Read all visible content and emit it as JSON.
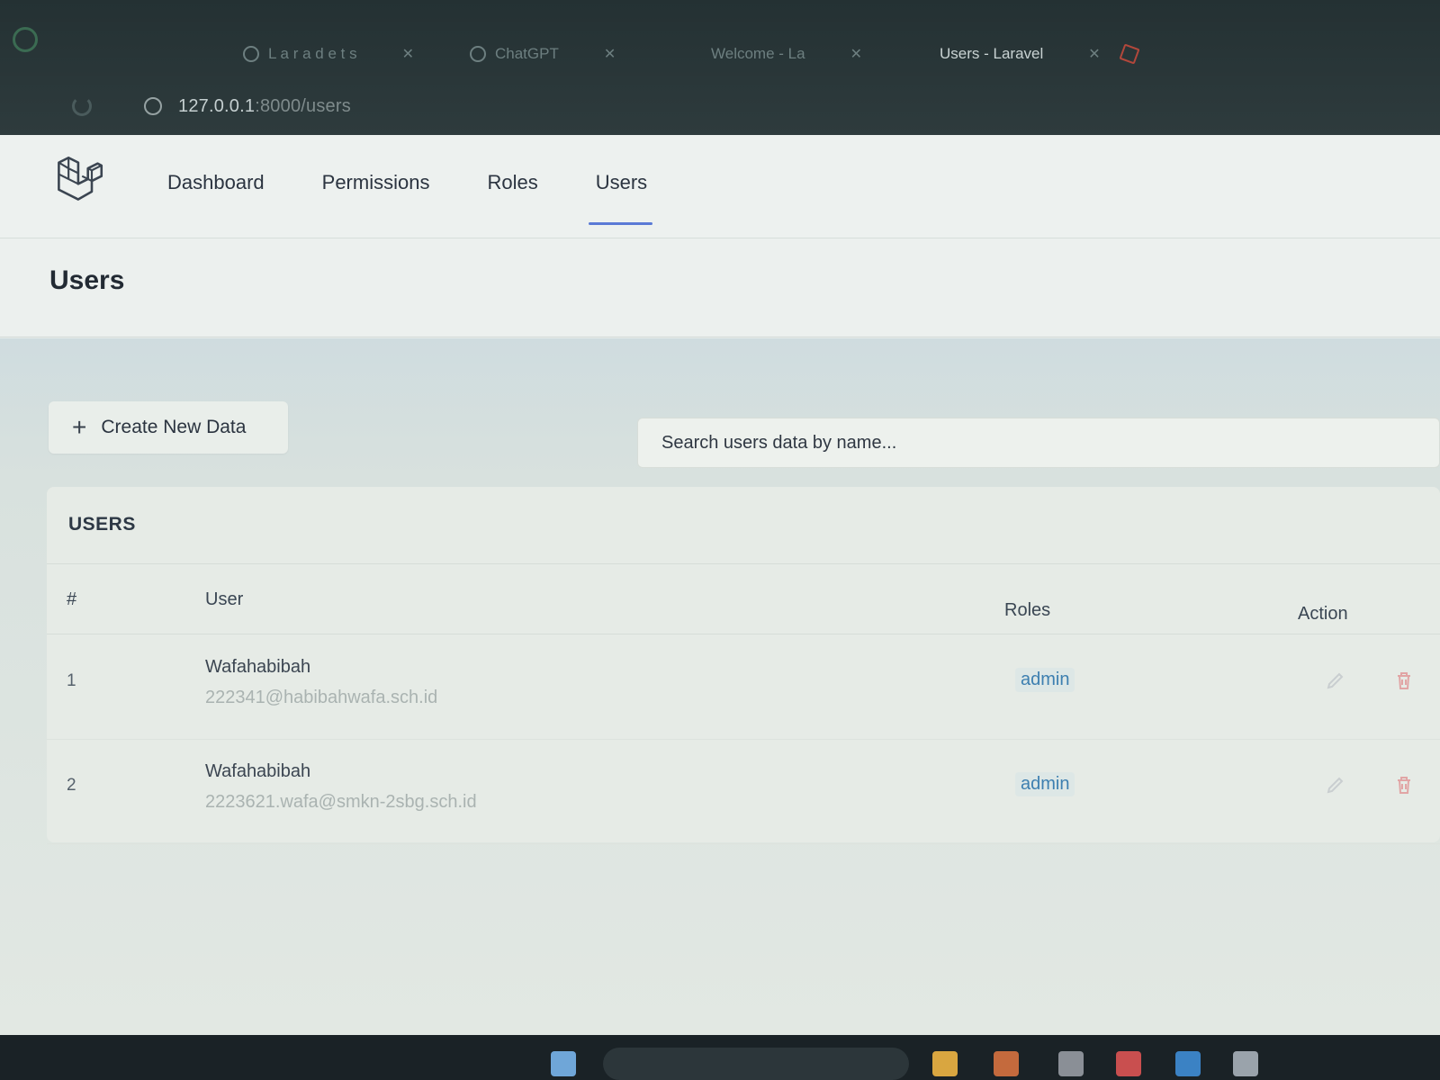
{
  "browser": {
    "tabs": [
      {
        "label": "L a r a d   e t s",
        "icon": "github-icon"
      },
      {
        "label": "ChatGPT",
        "icon": "chatgpt-icon"
      },
      {
        "label": "Welcome - La",
        "icon": "laravel-icon"
      },
      {
        "label": "Users - Laravel",
        "icon": "laravel-icon"
      },
      {
        "label": "",
        "icon": "laravel-icon"
      }
    ],
    "url_host": "127.0.0.1",
    "url_rest": ":8000/users"
  },
  "nav": {
    "links": [
      "Dashboard",
      "Permissions",
      "Roles",
      "Users"
    ],
    "active": "Users"
  },
  "page": {
    "title": "Users",
    "create_label": "Create New Data",
    "search_placeholder": "Search users data by name..."
  },
  "table": {
    "title": "USERS",
    "columns": [
      "#",
      "User",
      "Roles",
      "Action"
    ],
    "rows": [
      {
        "num": "1",
        "name": "Wafahabibah",
        "email": "222341@habibahwafa.sch.id",
        "role": "admin"
      },
      {
        "num": "2",
        "name": "Wafahabibah",
        "email": "2223621.wafa@smkn-2sbg.sch.id",
        "role": "admin"
      }
    ]
  },
  "colors": {
    "accent": "#5a7ad6",
    "role_badge": "#3d7fb0"
  }
}
